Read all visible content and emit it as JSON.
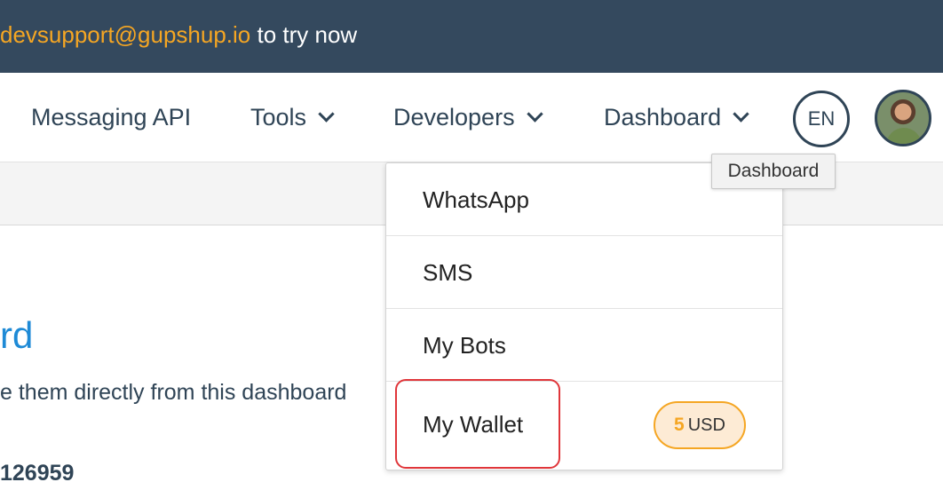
{
  "banner": {
    "email": "devsupport@gupshup.io",
    "suffix": " to try now"
  },
  "nav": {
    "messaging_api": "Messaging API",
    "tools": "Tools",
    "developers": "Developers",
    "dashboard": "Dashboard",
    "language": "EN"
  },
  "tooltip": {
    "text": "Dashboard"
  },
  "dropdown": {
    "items": [
      {
        "label": "WhatsApp"
      },
      {
        "label": "SMS"
      },
      {
        "label": "My Bots"
      },
      {
        "label": "My Wallet"
      }
    ],
    "wallet_amount": "5",
    "wallet_currency": "USD"
  },
  "page": {
    "title_fragment": "rd",
    "description_fragment": "e them directly from this dashboard",
    "id_fragment": "126959"
  },
  "colors": {
    "banner_bg": "#34495e",
    "accent_orange": "#f5a623",
    "title_blue": "#1e8ad6",
    "highlight_red": "#e0363a"
  }
}
